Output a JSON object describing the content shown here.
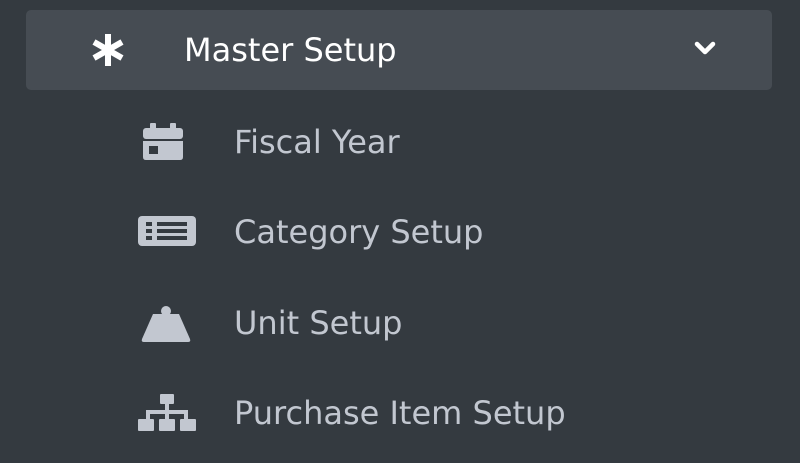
{
  "sidebar": {
    "header": {
      "label": "Master Setup",
      "icon": "asterisk-icon",
      "expand_icon": "chevron-down-icon",
      "expanded": true
    },
    "items": [
      {
        "label": "Fiscal Year",
        "icon": "calendar-icon"
      },
      {
        "label": "Category Setup",
        "icon": "list-icon"
      },
      {
        "label": "Unit Setup",
        "icon": "weight-icon"
      },
      {
        "label": "Purchase Item Setup",
        "icon": "sitemap-icon"
      }
    ]
  },
  "colors": {
    "sidebar_background": "#343a40",
    "header_background": "#464c53",
    "header_text": "#ffffff",
    "item_text": "#c2c7d0"
  }
}
